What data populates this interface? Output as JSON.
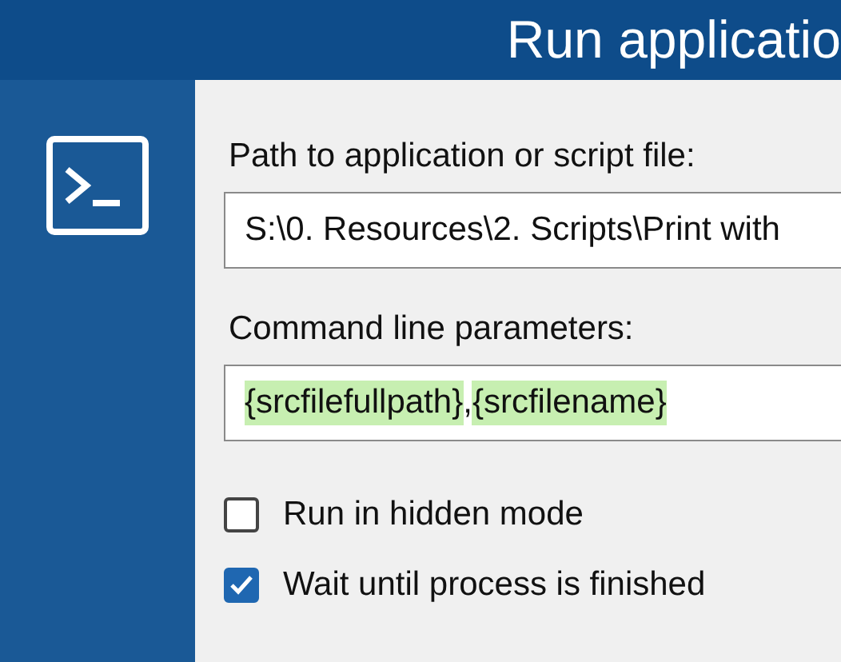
{
  "window": {
    "title": "Run applicatio"
  },
  "path_field": {
    "label": "Path to application or script file:",
    "value": "S:\\0. Resources\\2. Scripts\\Print with"
  },
  "params_field": {
    "label": "Command line parameters:",
    "segments": [
      {
        "text": "{srcfilefullpath}",
        "highlighted": true
      },
      {
        "text": ",",
        "highlighted": false
      },
      {
        "text": "{srcfilename}",
        "highlighted": true
      }
    ]
  },
  "options": [
    {
      "label": "Run in hidden mode",
      "checked": false
    },
    {
      "label": "Wait until process is finished",
      "checked": true
    }
  ]
}
